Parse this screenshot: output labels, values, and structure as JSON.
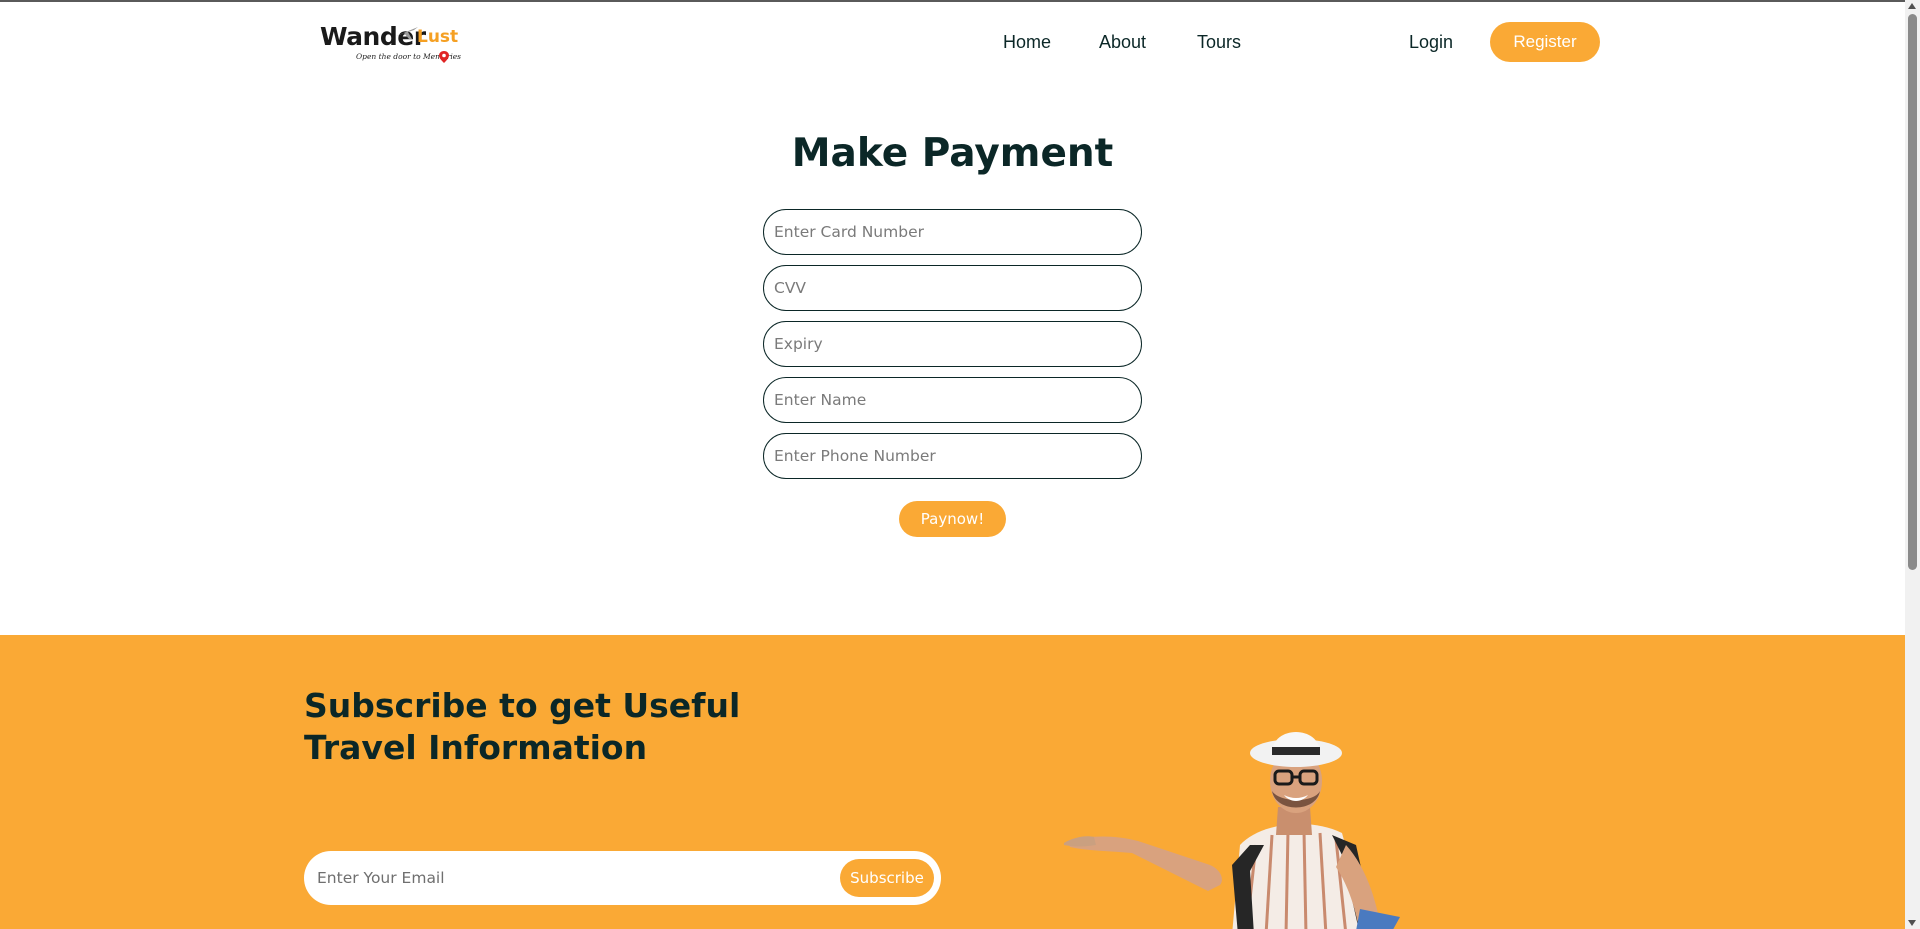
{
  "brand": {
    "name_part1": "Wander",
    "name_part2": "Lust",
    "tagline": "Open the door to Memories"
  },
  "nav": {
    "items": [
      {
        "label": "Home"
      },
      {
        "label": "About"
      },
      {
        "label": "Tours"
      }
    ],
    "login_label": "Login",
    "register_label": "Register"
  },
  "payment": {
    "title": "Make Payment",
    "fields": [
      {
        "placeholder": "Enter Card Number"
      },
      {
        "placeholder": "CVV"
      },
      {
        "placeholder": "Expiry"
      },
      {
        "placeholder": "Enter Name"
      },
      {
        "placeholder": "Enter Phone Number"
      }
    ],
    "submit_label": "Paynow!"
  },
  "newsletter": {
    "title": "Subscribe to get Useful Travel Information",
    "email_placeholder": "Enter Your Email",
    "subscribe_label": "Subscribe"
  },
  "colors": {
    "accent": "#faa935",
    "heading": "#0b2727",
    "background": "#ffffff"
  },
  "icons": [
    "plane-icon",
    "map-pin-icon",
    "scroll-up-icon",
    "scroll-down-icon"
  ]
}
